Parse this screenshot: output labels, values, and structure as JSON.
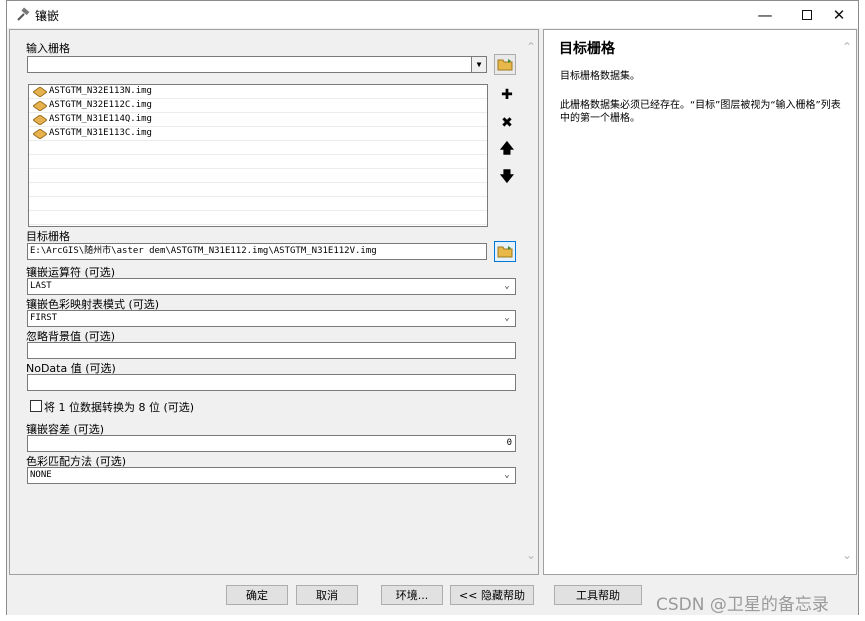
{
  "window": {
    "title": "镶嵌",
    "minimize_icon": "minimize-icon",
    "maximize_icon": "maximize-icon",
    "close_icon": "close-icon"
  },
  "form": {
    "input_raster_label": "输入栅格",
    "input_raster_value": "",
    "raster_list": [
      "ASTGTM_N32E113N.img",
      "ASTGTM_N32E112C.img",
      "ASTGTM_N31E114Q.img",
      "ASTGTM_N31E113C.img"
    ],
    "target_raster_label": "目标栅格",
    "target_raster_value": "E:\\ArcGIS\\随州市\\aster dem\\ASTGTM_N31E112.img\\ASTGTM_N31E112V.img",
    "mosaic_operator_label": "镶嵌运算符 (可选)",
    "mosaic_operator_value": "LAST",
    "colormap_mode_label": "镶嵌色彩映射表模式 (可选)",
    "colormap_mode_value": "FIRST",
    "ignore_bg_label": "忽略背景值 (可选)",
    "ignore_bg_value": "",
    "nodata_label": "NoData 值 (可选)",
    "nodata_value": "",
    "convert_1bit_label": "将 1 位数据转换为 8 位 (可选)",
    "convert_1bit_checked": false,
    "tolerance_label": "镶嵌容差 (可选)",
    "tolerance_value": "0",
    "color_match_label": "色彩匹配方法 (可选)",
    "color_match_value": "NONE"
  },
  "help": {
    "title": "目标栅格",
    "line1": "目标栅格数据集。",
    "line2": "此栅格数据集必须已经存在。“目标”图层被视为“输入栅格”列表中的第一个栅格。"
  },
  "buttons": {
    "ok": "确定",
    "cancel": "取消",
    "environments": "环境...",
    "hide_help": "<< 隐藏帮助",
    "tool_help": "工具帮助"
  },
  "watermark": "CSDN @卫星的备忘录",
  "colors": {
    "accent": "#0078d7",
    "folder": "#e8b84a",
    "raster_icon": "#e5b24e"
  }
}
